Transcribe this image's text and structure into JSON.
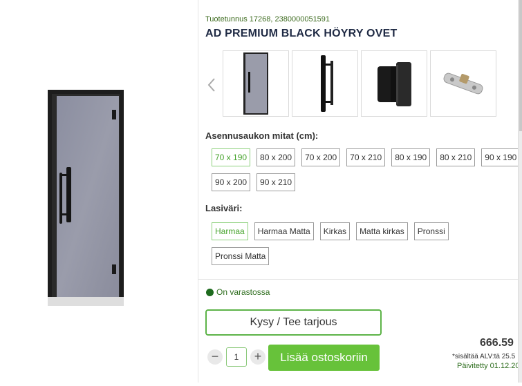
{
  "product": {
    "sku": "Tuotetunnus 17268, 2380000051591",
    "title": "AD PREMIUM BLACK HÖYRY OVET"
  },
  "gallery": {
    "prev_icon": "chevron-left-icon",
    "thumbnails": [
      "door-thumbnail",
      "handle-thumbnail",
      "hinge-thumbnail",
      "latch-thumbnail"
    ]
  },
  "sizes": {
    "label": "Asennusaukon mitat (cm):",
    "options": [
      "70 x 190",
      "80 x 200",
      "70 x 200",
      "70 x 210",
      "80 x 190",
      "80 x 210",
      "90 x 190",
      "90 x 200",
      "90 x 210"
    ],
    "selected": "70 x 190"
  },
  "glass": {
    "label": "Lasiväri:",
    "options": [
      "Harmaa",
      "Harmaa Matta",
      "Kirkas",
      "Matta kirkas",
      "Pronssi",
      "Pronssi Matta"
    ],
    "selected": "Harmaa"
  },
  "stock": {
    "text": "On varastossa",
    "color": "#1e6b1e"
  },
  "actions": {
    "quote_label": "Kysy / Tee tarjous",
    "qty_minus": "−",
    "qty_plus": "+",
    "qty_value": "1",
    "add_to_cart_label": "Lisää ostoskoriin"
  },
  "price": {
    "amount": "666.59",
    "vat_note": "*sisältää ALV:tä 25.5",
    "updated": "Päivitetty 01.12.20"
  },
  "colors": {
    "accent_green": "#67c23a",
    "selected_green": "#44a22a",
    "title_navy": "#1f2a44"
  }
}
